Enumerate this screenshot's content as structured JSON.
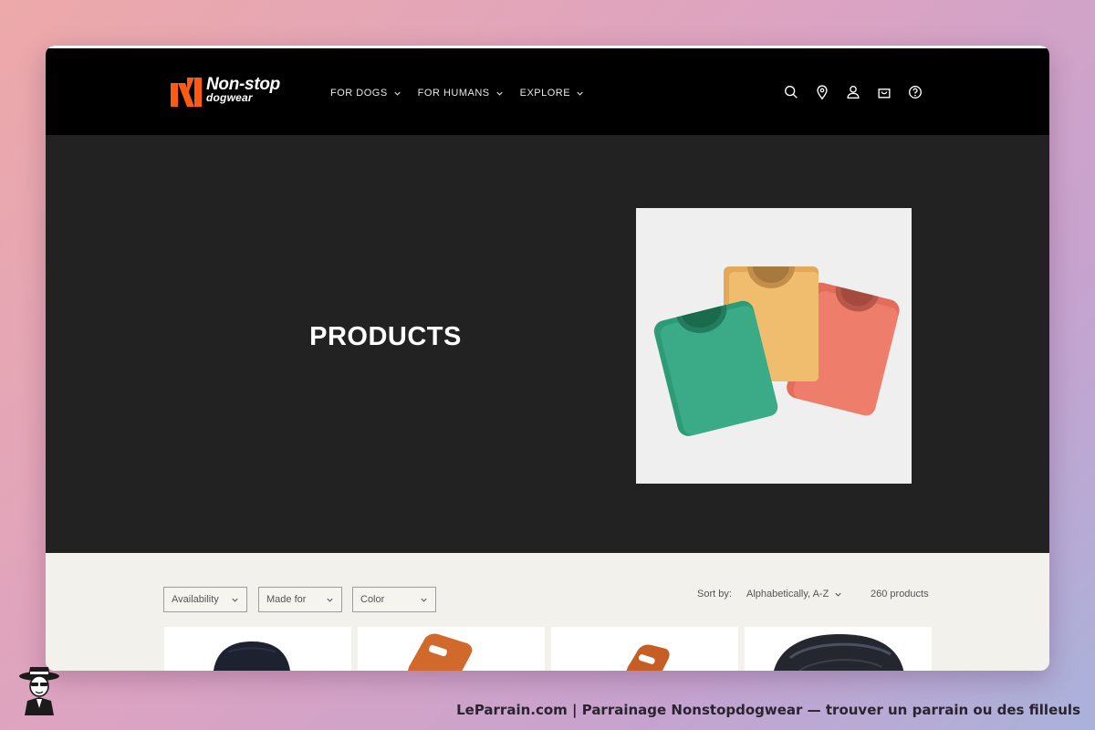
{
  "header": {
    "logo": {
      "line1": "Non-stop",
      "line2": "dogwear",
      "brand_color": "#ff5a12"
    },
    "nav": [
      {
        "label": "FOR DOGS",
        "icon": "chevron-down-icon"
      },
      {
        "label": "FOR HUMANS",
        "icon": "chevron-down-icon"
      },
      {
        "label": "EXPLORE",
        "icon": "chevron-down-icon"
      }
    ],
    "icons": [
      "search-icon",
      "location-pin-icon",
      "account-icon",
      "cart-icon",
      "help-icon"
    ]
  },
  "hero": {
    "title": "PRODUCTS",
    "image": "folded-shirts-illustration",
    "colors": {
      "dark": "#222222",
      "light": "#f3f3f3"
    }
  },
  "filters": {
    "items": [
      {
        "label": "Availability"
      },
      {
        "label": "Made for"
      },
      {
        "label": "Color"
      }
    ],
    "sort_label": "Sort by:",
    "sort_value": "Alphabetically, A-Z",
    "product_count": "260 products"
  },
  "products": [
    {
      "image": "black-beanie-icon"
    },
    {
      "image": "orange-buckle-icon"
    },
    {
      "image": "orange-buckle-icon"
    },
    {
      "image": "black-bag-icon"
    }
  ],
  "footer": {
    "caption": "LeParrain.com | Parrainage Nonstopdogwear — trouver un parrain ou des filleuls",
    "mascot": "mascot-icon"
  }
}
